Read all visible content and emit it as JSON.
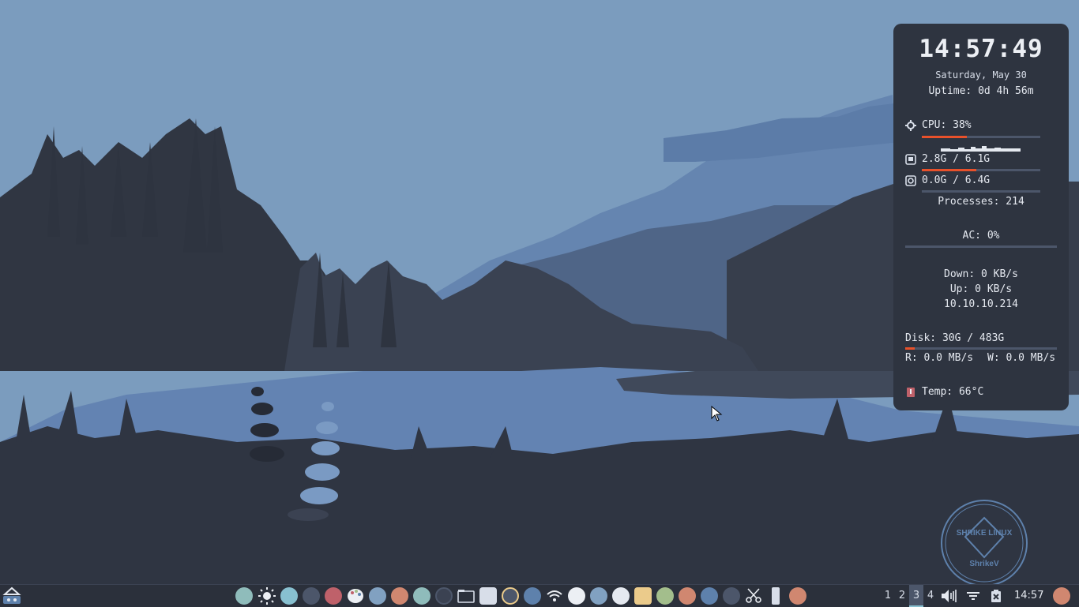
{
  "conky": {
    "clock": "14:57:49",
    "date": "Saturday, May 30",
    "uptime": "Uptime: 0d 4h 56m",
    "cpu": {
      "label": "CPU: 38%",
      "percent": 38
    },
    "memory": {
      "label": "2.8G / 6.1G",
      "percent": 46
    },
    "swap": {
      "label": "0.0G / 6.4G",
      "percent": 0
    },
    "processes": "Processes: 214",
    "battery": {
      "label": "AC: 0%",
      "percent": 0
    },
    "network": {
      "down": "Down: 0 KB/s",
      "up": "Up: 0 KB/s",
      "ip": "10.10.10.214"
    },
    "disk": {
      "label": "Disk: 30G / 483G",
      "percent": 6,
      "read": "R: 0.0 MB/s",
      "write": "W: 0.0 MB/s"
    },
    "temp": "Temp: 66°C"
  },
  "logo": {
    "top": "SHRIKE LINUX",
    "bottom": "ShrikeV"
  },
  "taskbar": {
    "workspaces": [
      "1",
      "2",
      "3",
      "4"
    ],
    "active_workspace": 2,
    "clock": "14:57"
  },
  "colors": {
    "panel": "#2e3440",
    "accent": "#e8512b",
    "taskbar": "#2b303b"
  }
}
